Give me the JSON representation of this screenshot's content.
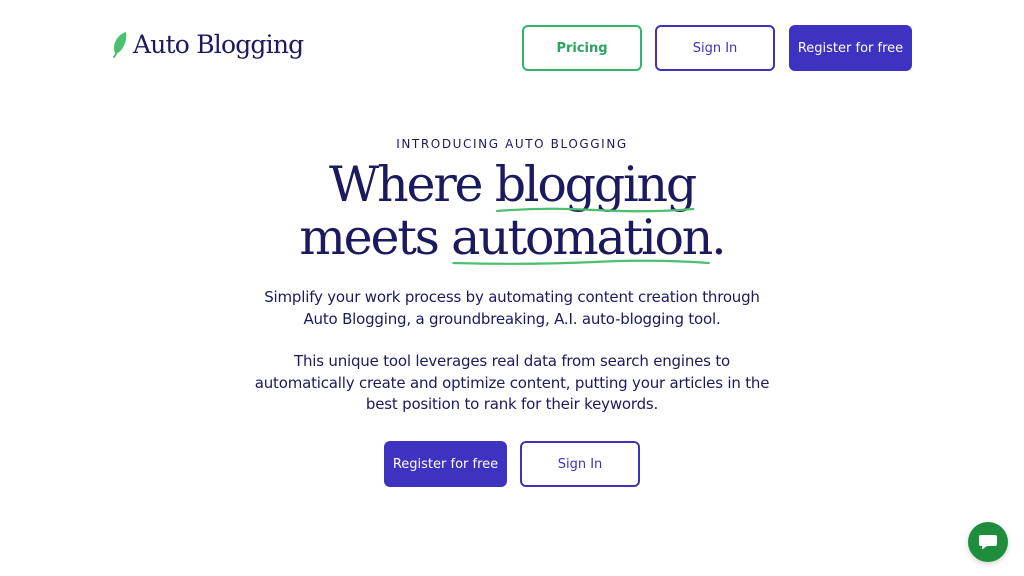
{
  "brand": {
    "name": "Auto Blogging",
    "icon": "quill-icon",
    "accent_green": "#33b56b",
    "accent_purple": "#3d33c0",
    "text_navy": "#1c1a5e"
  },
  "header": {
    "pricing_label": "Pricing",
    "signin_label": "Sign In",
    "register_label": "Register for free"
  },
  "hero": {
    "eyebrow": "INTRODUCING AUTO BLOGGING",
    "headline_1_prefix": "Where ",
    "headline_1_highlight": "blogging",
    "headline_2_prefix": "meets ",
    "headline_2_highlight": "automation",
    "headline_2_suffix": ".",
    "paragraph_1": [
      "Simplify your work process by automating content creation through",
      "Auto Blogging, a groundbreaking, A.I. auto-blogging tool."
    ],
    "paragraph_2": [
      "This unique tool leverages real data from search engines to",
      "automatically create and optimize content, putting your articles in the",
      "best position to rank for their keywords."
    ],
    "cta_register_label": "Register for free",
    "cta_signin_label": "Sign In"
  },
  "chat": {
    "icon": "chat-bubble-icon"
  }
}
